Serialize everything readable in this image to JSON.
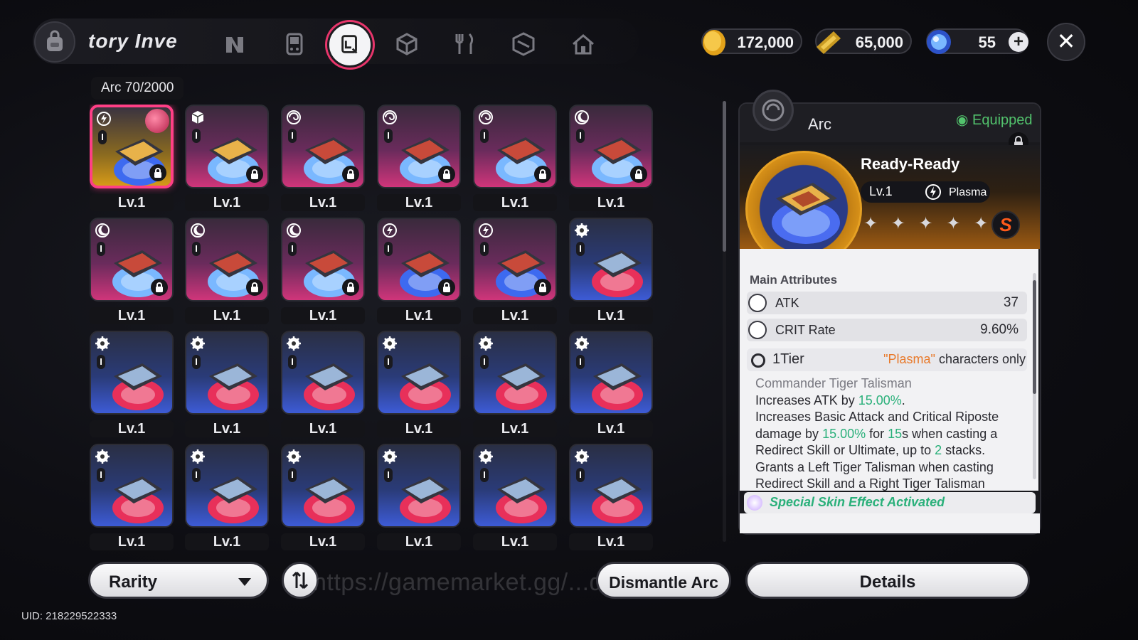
{
  "header": {
    "title": "tory  Inve",
    "tabs": [
      {
        "name": "tab-character",
        "icon": "n-logo-icon"
      },
      {
        "name": "tab-device",
        "icon": "handheld-device-icon"
      },
      {
        "name": "tab-arc",
        "icon": "arc-card-icon",
        "active": true
      },
      {
        "name": "tab-materials",
        "icon": "cube-icon"
      },
      {
        "name": "tab-food",
        "icon": "fork-knife-icon"
      },
      {
        "name": "tab-package",
        "icon": "box-icon"
      },
      {
        "name": "tab-home",
        "icon": "home-icon"
      }
    ]
  },
  "currencies": {
    "gold": "172,000",
    "ticket": "65,000",
    "gem": "55"
  },
  "inventory": {
    "counter": "Arc 70/2000",
    "level_label": "Lv.1",
    "level_label_cut": "Lv.1",
    "items": [
      {
        "rarity": "gold",
        "element": "plasma",
        "locked": true,
        "selected": true
      },
      {
        "rarity": "pink",
        "element": "cube",
        "locked": true
      },
      {
        "rarity": "pink",
        "element": "swirl",
        "locked": true
      },
      {
        "rarity": "pink",
        "element": "swirl",
        "locked": true
      },
      {
        "rarity": "pink",
        "element": "swirl",
        "locked": true
      },
      {
        "rarity": "pink",
        "element": "moon",
        "locked": true
      },
      {
        "rarity": "pink",
        "element": "moon",
        "locked": true
      },
      {
        "rarity": "pink",
        "element": "moon",
        "locked": true
      },
      {
        "rarity": "pink",
        "element": "moon",
        "locked": true
      },
      {
        "rarity": "pink",
        "element": "plasma",
        "locked": true
      },
      {
        "rarity": "pink",
        "element": "plasma",
        "locked": true
      },
      {
        "rarity": "blue",
        "element": "gear",
        "locked": false
      }
    ]
  },
  "footer": {
    "rarity_label": "Rarity",
    "dismantle_label": "Dismantle Arc",
    "details_label": "Details",
    "uid": "UID: 218229522333",
    "watermark": "https://gamemarket.gg/...dn.hu"
  },
  "detail": {
    "category": "Arc",
    "equipped": "Equipped",
    "name": "Ready-Ready",
    "level": "Lv.1",
    "element": "Plasma",
    "stars": "✦ ✦ ✦ ✦ ✦ ✦",
    "grade": "S",
    "main_attributes_title": "Main Attributes",
    "attributes": [
      {
        "label": "ATK",
        "value": "37"
      },
      {
        "label": "CRIT Rate",
        "value": "9.60%"
      }
    ],
    "tier_label": "1Tier",
    "tier_quote": "\"Plasma\"",
    "tier_condition": " characters only",
    "effect_name": "Commander Tiger Talisman",
    "line1_a": "Increases ATK by ",
    "line1_b": "15.00%",
    "line1_c": ".",
    "line2": "Increases Basic Attack and Critical Riposte",
    "line3_a": "damage by ",
    "line3_b": "15.00%",
    "line3_c": " for ",
    "line3_d": "15",
    "line3_e": "s when casting a",
    "line4_a": "Redirect Skill or Ultimate, up to ",
    "line4_b": "2",
    "line4_c": " stacks.",
    "line5": "Grants a Left Tiger Talisman when casting",
    "line6": "Redirect Skill and a Right Tiger Talisman",
    "special": "Special Skin Effect Activated"
  },
  "colors": {
    "accent_pink": "#ff3f86",
    "rarity_pink": "#d0357a",
    "rarity_blue": "#3d5bd6",
    "rarity_gold": "#d69a18",
    "equipped_green": "#52c26c",
    "highlight_green": "#2ab07a",
    "plasma_orange": "#e8792a"
  }
}
